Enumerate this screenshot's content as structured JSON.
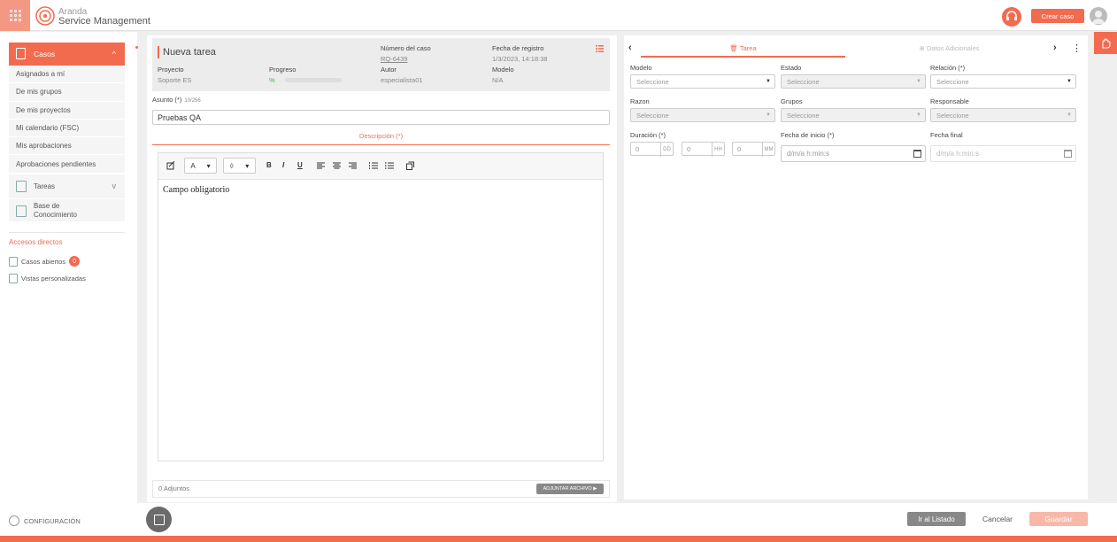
{
  "brand": {
    "name_top": "Aranda",
    "name_bottom": "Service Management"
  },
  "header": {
    "create_case_label": "Crear caso"
  },
  "sidebar": {
    "casos_label": "Casos",
    "casos_items": [
      "Asignados a mí",
      "De mis grupos",
      "De mis proyectos",
      "Mi calendario (FSC)",
      "Mis aprobaciones",
      "Aprobaciones pendientes"
    ],
    "tareas_label": "Tareas",
    "base_label_1": "Base de",
    "base_label_2": "Conocimiento",
    "accesos_title": "Accesos directos",
    "casos_abiertos": "Casos abiertos",
    "casos_abiertos_count": "0",
    "vistas": "Vistas personalizadas",
    "config": "CONFIGURACIÓN"
  },
  "task": {
    "title": "Nueva tarea",
    "numero_label": "Número del caso",
    "numero_value": "RQ-6439",
    "fecha_label": "Fecha de registro",
    "fecha_value": "1/3/2023, 14:18:38",
    "proyecto_label": "Proyecto",
    "proyecto_value": "Soporte ES",
    "progreso_label": "Progreso",
    "progreso_pct": "%",
    "progreso_fraction": 0.0,
    "autor_label": "Autor",
    "autor_value": "especialista01",
    "modelo_label": "Modelo",
    "modelo_value": "N/A"
  },
  "asunto": {
    "label": "Asunto (*)",
    "count": "10/256",
    "value": "Pruebas QA"
  },
  "descripcion": {
    "tab_label": "Descripción (*)",
    "text": "Campo obligatorio"
  },
  "toolbar": {
    "font_color": "A",
    "bold": "B",
    "italic": "I",
    "underline": "U"
  },
  "adjuntos": {
    "label": "0 Adjuntos",
    "button": "ADJUNTAR ARCHIVO"
  },
  "right_tabs": {
    "tarea": "Tarea",
    "datos": "Datos Adicionales"
  },
  "form": {
    "modelo_label": "Modelo",
    "modelo_value": "Seleccione",
    "estado_label": "Estado",
    "estado_value": "Seleccione",
    "relacion_label": "Relación (*)",
    "relacion_value": "Seleccione",
    "razon_label": "Razon",
    "razon_value": "Seleccione",
    "grupos_label": "Grupos",
    "grupos_value": "Seleccione",
    "responsable_label": "Responsable",
    "responsable_value": "Seleccione",
    "duracion_label": "Duración (*)",
    "dd_value": "0",
    "dd_unit": "DD",
    "hh_value": "0",
    "hh_unit": "HH",
    "mm_value": "0",
    "mm_unit": "MM",
    "inicio_label": "Fecha de inicio (*)",
    "inicio_placeholder": "d/m/a h:min:s",
    "final_label": "Fecha final",
    "final_placeholder": "d/m/a h:min:s"
  },
  "footer": {
    "ir_listado": "Ir al Listado",
    "cancelar": "Cancelar",
    "guardar": "Guardar"
  },
  "colors": {
    "accent": "#f36b4f",
    "accent_light": "#f8b8a8",
    "grey_button": "#888888"
  }
}
